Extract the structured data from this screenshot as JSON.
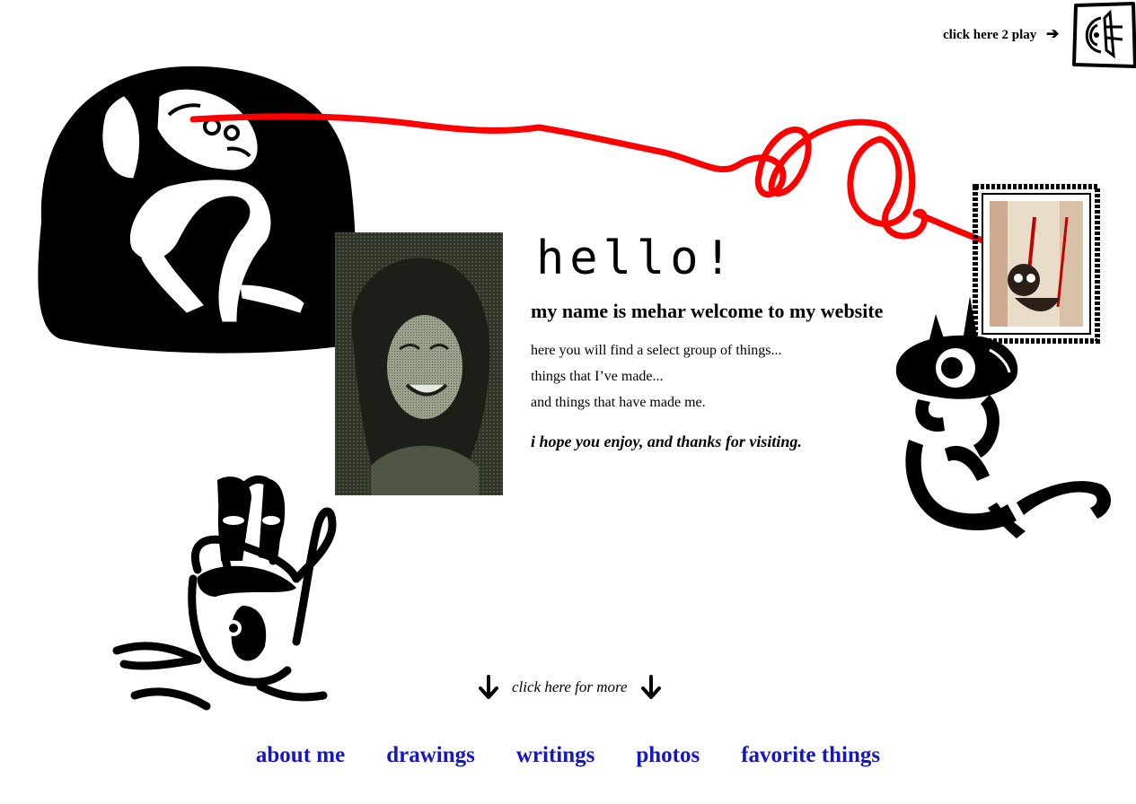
{
  "header": {
    "play_label": "click here 2 play",
    "play_arrow": "➔",
    "speaker_icon": "speaker-icon"
  },
  "intro": {
    "greeting": "hello!",
    "heading": "my name is mehar welcome to my website",
    "lines": [
      "here you will find a select group of things...",
      "things that I’ve made...",
      "and things that have made me."
    ],
    "closing": "i hope you enjoy, and thanks for visiting."
  },
  "more": {
    "label": "click here for more",
    "icon": "down-arrow-icon"
  },
  "nav": {
    "items": [
      {
        "label": "about me"
      },
      {
        "label": "drawings"
      },
      {
        "label": "writings"
      },
      {
        "label": "photos"
      },
      {
        "label": "favorite things"
      }
    ]
  },
  "colors": {
    "link": "#1515c9",
    "scribble": "#ff0000",
    "ink": "#000000",
    "background": "#ffffff"
  }
}
